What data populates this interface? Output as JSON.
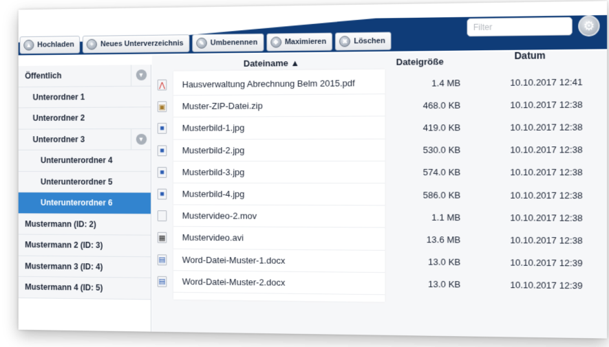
{
  "toolbar": {
    "buttons": [
      {
        "label": "Hochladen",
        "icon": "upload-icon"
      },
      {
        "label": "Neues Unterverzeichnis",
        "icon": "new-folder-icon"
      },
      {
        "label": "Umbenennen",
        "icon": "rename-icon"
      },
      {
        "label": "Maximieren",
        "icon": "maximize-icon"
      },
      {
        "label": "Löschen",
        "icon": "delete-icon"
      }
    ],
    "filter_placeholder": "Filter",
    "filter_value": "",
    "settings_icon": "gear-icon"
  },
  "sidebar": {
    "items": [
      {
        "label": "Öffentlich",
        "level": 0,
        "expander": true
      },
      {
        "label": "Unterordner 1",
        "level": 1
      },
      {
        "label": "Unterordner 2",
        "level": 1
      },
      {
        "label": "Unterordner 3",
        "level": 1,
        "expander": true
      },
      {
        "label": "Unterunterordner 4",
        "level": 2
      },
      {
        "label": "Unterunterordner 5",
        "level": 2
      },
      {
        "label": "Unterunterordner 6",
        "level": 2,
        "active": true
      },
      {
        "label": "Mustermann (ID: 2)",
        "level": 0
      },
      {
        "label": "Mustermann 2 (ID: 3)",
        "level": 0
      },
      {
        "label": "Mustermann 3 (ID: 4)",
        "level": 0
      },
      {
        "label": "Mustermann 4 (ID: 5)",
        "level": 0
      }
    ]
  },
  "files": {
    "columns": {
      "name": "Dateiname ▲",
      "size": "Dateigröße",
      "date": "Datum"
    },
    "rows": [
      {
        "name": "Hausverwaltung Abrechnung Belm 2015.pdf",
        "size": "1.4 MB",
        "date": "10.10.2017 12:41",
        "icon": "pdf-icon"
      },
      {
        "name": "Muster-ZIP-Datei.zip",
        "size": "468.0 KB",
        "date": "10.10.2017 12:38",
        "icon": "zip-icon"
      },
      {
        "name": "Musterbild-1.jpg",
        "size": "419.0 KB",
        "date": "10.10.2017 12:38",
        "icon": "image-icon"
      },
      {
        "name": "Musterbild-2.jpg",
        "size": "530.0 KB",
        "date": "10.10.2017 12:38",
        "icon": "image-icon"
      },
      {
        "name": "Musterbild-3.jpg",
        "size": "574.0 KB",
        "date": "10.10.2017 12:38",
        "icon": "image-icon"
      },
      {
        "name": "Musterbild-4.jpg",
        "size": "586.0 KB",
        "date": "10.10.2017 12:38",
        "icon": "image-icon"
      },
      {
        "name": "Mustervideo-2.mov",
        "size": "1.1 MB",
        "date": "10.10.2017 12:38",
        "icon": "file-icon"
      },
      {
        "name": "Mustervideo.avi",
        "size": "13.6 MB",
        "date": "10.10.2017 12:38",
        "icon": "video-icon"
      },
      {
        "name": "Word-Datei-Muster-1.docx",
        "size": "13.0 KB",
        "date": "10.10.2017 12:39",
        "icon": "document-icon"
      },
      {
        "name": "Word-Datei-Muster-2.docx",
        "size": "13.0 KB",
        "date": "10.10.2017 12:39",
        "icon": "document-icon"
      }
    ]
  },
  "colors": {
    "header_blue": "#0f3c78",
    "active_blue": "#3284cf",
    "pdf_red": "#d0312d"
  }
}
